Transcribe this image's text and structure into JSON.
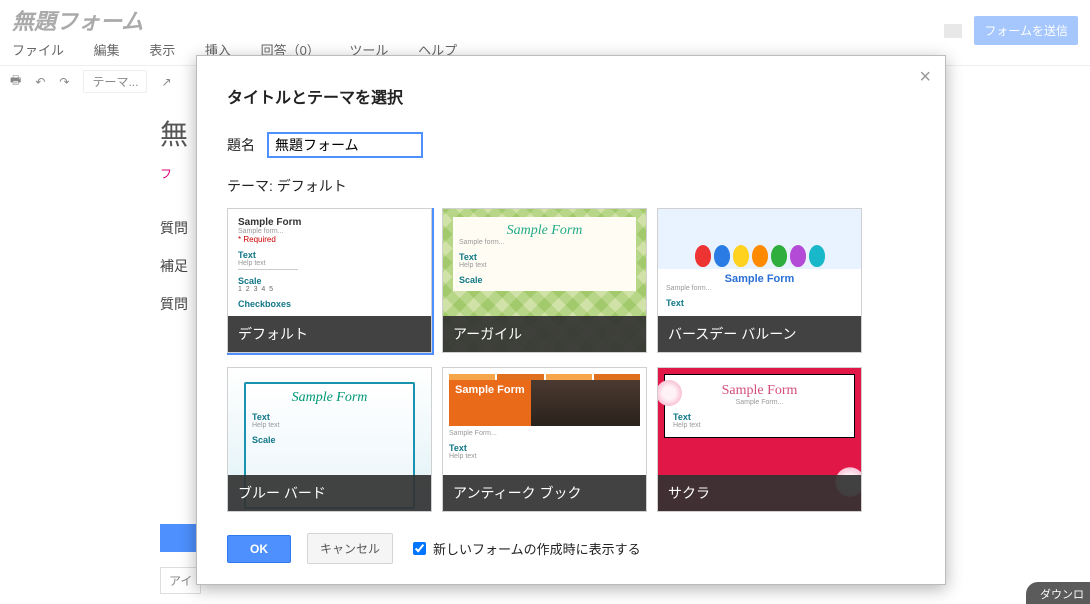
{
  "app": {
    "title": "無題フォーム",
    "menus": [
      "ファイル",
      "編集",
      "表示",
      "挿入",
      "回答（0）",
      "ツール",
      "ヘルプ"
    ],
    "send_label": "フォームを送信",
    "toolbar_theme_label": "テーマ..."
  },
  "backdrop": {
    "title_fragment": "無",
    "tab_fragment": "フ",
    "labels": [
      "質問",
      "補足",
      "質問"
    ],
    "pill": "アイ"
  },
  "dialog": {
    "title": "タイトルとテーマを選択",
    "title_field_label": "題名",
    "title_value": "無題フォーム",
    "theme_prefix": "テーマ: ",
    "current_theme": "デフォルト",
    "themes": [
      {
        "name": "デフォルト",
        "sample": "Sample Form",
        "selected": true
      },
      {
        "name": "アーガイル",
        "sample": "Sample Form",
        "selected": false
      },
      {
        "name": "バースデー バルーン",
        "sample": "Sample Form",
        "selected": false
      },
      {
        "name": "ブルー バード",
        "sample": "Sample Form",
        "selected": false
      },
      {
        "name": "アンティーク ブック",
        "sample": "Sample Form",
        "selected": false
      },
      {
        "name": "サクラ",
        "sample": "Sample Form",
        "selected": false
      }
    ],
    "ok": "OK",
    "cancel": "キャンセル",
    "startup_checkbox": "新しいフォームの作成時に表示する",
    "startup_checked": true
  },
  "download_pill": "ダウンロ"
}
